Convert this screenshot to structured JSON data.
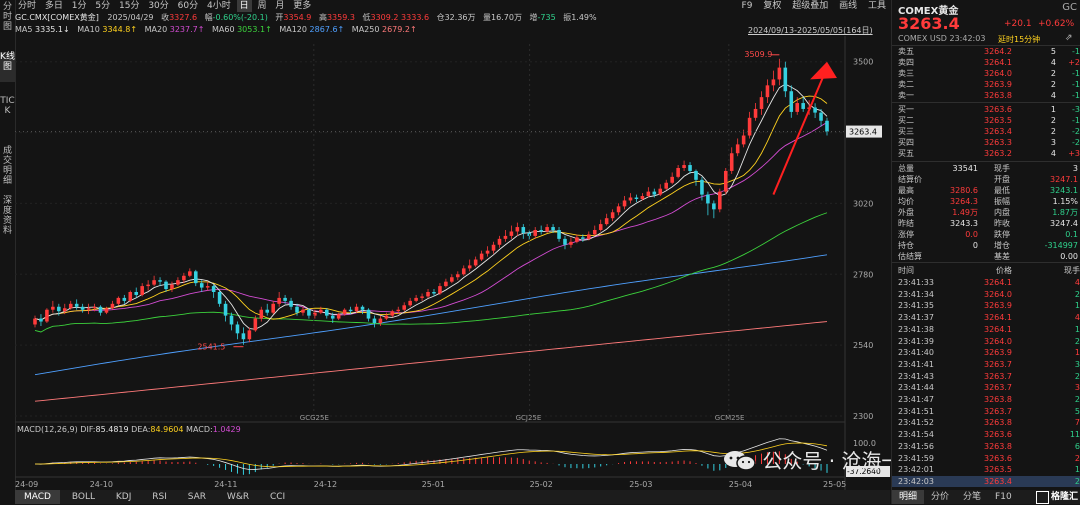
{
  "left_tabs": [
    "分时图",
    "K线图",
    "TICK",
    "成交明细",
    "深度资料"
  ],
  "periods": [
    "分时",
    "多日",
    "1分",
    "5分",
    "15分",
    "30分",
    "60分",
    "4小时",
    "日",
    "周",
    "月",
    "更多"
  ],
  "active_period": "日",
  "top_links": [
    "F9",
    "复权",
    "超级叠加",
    "画线",
    "工具"
  ],
  "info": {
    "symbol": "GC.CMX[COMEX黄金]",
    "date": "2025/04/29",
    "close_label": "收",
    "close": "3327.6",
    "chg_label": "幅",
    "chg": "-0.60%(-20.1)",
    "open_label": "开",
    "open": "3354.9",
    "high_label": "高",
    "high": "3359.3",
    "low_label": "低",
    "low": "3309.2",
    "last": "3333.6",
    "oi_label": "仓",
    "oi": "32.36万",
    "vol_label": "量",
    "vol": "16.70万",
    "inc_label": "增",
    "inc": "-735",
    "amp_label": "振",
    "amp": "1.49%"
  },
  "ma": [
    {
      "label": "MA5",
      "value": "3335.1↓",
      "color": "#e6e6e6"
    },
    {
      "label": "MA10",
      "value": "3344.8↑",
      "color": "#ffd21f"
    },
    {
      "label": "MA20",
      "value": "3237.7↑",
      "color": "#d24cd2"
    },
    {
      "label": "MA60",
      "value": "3053.1↑",
      "color": "#3cd23c"
    },
    {
      "label": "MA120",
      "value": "2867.6↑",
      "color": "#4fa0ff"
    },
    {
      "label": "MA250",
      "value": "2679.2↑",
      "color": "#ff7a7a"
    }
  ],
  "range_label": "2024/09/13-2025/05/05(164日)",
  "price_axis": [
    "3500",
    "3260",
    "3020",
    "2780",
    "2540",
    "2300"
  ],
  "current_price_tag": "3263.4",
  "max_label": "3509.9",
  "min_label": "2541.5",
  "contract_labels": [
    "GCG25E",
    "GCJ25E",
    "GCM25E"
  ],
  "macd": {
    "title": "MACD(12,26,9)",
    "dif_label": "DIF:",
    "dif": "85.4819",
    "dea_label": "DEA:",
    "dea": "84.9604",
    "macd_label": "MACD:",
    "macd": "1.0429",
    "axis_top": "100.0",
    "axis_bot": "-37.2640"
  },
  "date_axis": [
    "24-09",
    "24-10",
    "24-11",
    "24-12",
    "25-01",
    "25-02",
    "25-03",
    "25-04",
    "25-05"
  ],
  "bottom_tabs": [
    "MACD",
    "BOLL",
    "KDJ",
    "RSI",
    "SAR",
    "W&R",
    "CCI"
  ],
  "watermark": "公众号 · 沧海一土狗",
  "right": {
    "name": "COMEX黄金",
    "code": "GC",
    "price": "3263.4",
    "chg": "+20.1",
    "pct": "+0.62%",
    "sub": "COMEX  USD  23:42:03",
    "delay": "延时15分钟",
    "asks": [
      {
        "l": "卖五",
        "p": "3264.2",
        "v": "5",
        "d": "-1"
      },
      {
        "l": "卖四",
        "p": "3264.1",
        "v": "4",
        "d": "+2"
      },
      {
        "l": "卖三",
        "p": "3264.0",
        "v": "2",
        "d": "-1"
      },
      {
        "l": "卖二",
        "p": "3263.9",
        "v": "2",
        "d": "-1"
      },
      {
        "l": "卖一",
        "p": "3263.8",
        "v": "4",
        "d": "-1"
      }
    ],
    "bids": [
      {
        "l": "买一",
        "p": "3263.6",
        "v": "1",
        "d": "-3"
      },
      {
        "l": "买二",
        "p": "3263.5",
        "v": "2",
        "d": "-1"
      },
      {
        "l": "买三",
        "p": "3263.4",
        "v": "2",
        "d": "-2"
      },
      {
        "l": "买四",
        "p": "3263.3",
        "v": "3",
        "d": "-2"
      },
      {
        "l": "买五",
        "p": "3263.2",
        "v": "4",
        "d": "+3"
      }
    ],
    "stats": [
      {
        "a": "总量",
        "av": "33541",
        "b": "现手",
        "bv": "3"
      },
      {
        "a": "结算价",
        "av": "",
        "b": "开盘",
        "bv": "3247.1"
      },
      {
        "a": "最高",
        "av": "3280.6",
        "b": "最低",
        "bv": "3243.1"
      },
      {
        "a": "均价",
        "av": "3264.3",
        "b": "振幅",
        "bv": "1.15%"
      },
      {
        "a": "外盘",
        "av": "1.49万",
        "b": "内盘",
        "bv": "1.87万"
      },
      {
        "a": "昨结",
        "av": "3243.3",
        "b": "昨收",
        "bv": "3247.4"
      },
      {
        "a": "涨停",
        "av": "0.0",
        "b": "跌停",
        "bv": "0.1"
      },
      {
        "a": "持仓",
        "av": "0",
        "b": "增仓",
        "bv": "-314997"
      },
      {
        "a": "估结算",
        "av": "",
        "b": "基差",
        "bv": "0.00"
      }
    ],
    "tick_head": [
      "时间",
      "价格",
      "现手"
    ],
    "ticks": [
      {
        "t": "23:41:33",
        "p": "3264.1",
        "v": "4"
      },
      {
        "t": "23:41:34",
        "p": "3264.0",
        "v": "2"
      },
      {
        "t": "23:41:35",
        "p": "3263.9",
        "v": "1"
      },
      {
        "t": "23:41:37",
        "p": "3264.1",
        "v": "4"
      },
      {
        "t": "23:41:38",
        "p": "3264.1",
        "v": "1"
      },
      {
        "t": "23:41:39",
        "p": "3264.0",
        "v": "2"
      },
      {
        "t": "23:41:40",
        "p": "3263.9",
        "v": "1"
      },
      {
        "t": "23:41:41",
        "p": "3263.7",
        "v": "3"
      },
      {
        "t": "23:41:43",
        "p": "3263.7",
        "v": "2"
      },
      {
        "t": "23:41:44",
        "p": "3263.7",
        "v": "3"
      },
      {
        "t": "23:41:47",
        "p": "3263.8",
        "v": "2"
      },
      {
        "t": "23:41:51",
        "p": "3263.7",
        "v": "5"
      },
      {
        "t": "23:41:52",
        "p": "3263.8",
        "v": "7"
      },
      {
        "t": "23:41:54",
        "p": "3263.6",
        "v": "11"
      },
      {
        "t": "23:41:56",
        "p": "3263.8",
        "v": "6"
      },
      {
        "t": "23:41:59",
        "p": "3263.6",
        "v": "2"
      },
      {
        "t": "23:42:01",
        "p": "3263.5",
        "v": "1"
      },
      {
        "t": "23:42:03",
        "p": "3263.4",
        "v": "2"
      }
    ],
    "bottom_tabs": [
      "明细",
      "分价",
      "分笔",
      "F10"
    ],
    "logo": "格隆汇"
  },
  "chart_data": {
    "type": "candlestick",
    "y_range": [
      2300,
      3560
    ],
    "x_labels": [
      "24-09",
      "24-10",
      "24-11",
      "24-12",
      "25-01",
      "25-02",
      "25-03",
      "25-04",
      "25-05"
    ],
    "candles": [
      [
        2610,
        2630,
        2600,
        2640
      ],
      [
        2630,
        2620,
        2605,
        2645
      ],
      [
        2620,
        2660,
        2615,
        2665
      ],
      [
        2660,
        2670,
        2650,
        2690
      ],
      [
        2670,
        2655,
        2640,
        2680
      ],
      [
        2655,
        2665,
        2645,
        2680
      ],
      [
        2665,
        2680,
        2660,
        2690
      ],
      [
        2680,
        2670,
        2660,
        2695
      ],
      [
        2670,
        2660,
        2650,
        2680
      ],
      [
        2660,
        2665,
        2645,
        2680
      ],
      [
        2665,
        2670,
        2655,
        2680
      ],
      [
        2670,
        2650,
        2640,
        2675
      ],
      [
        2650,
        2665,
        2645,
        2670
      ],
      [
        2665,
        2680,
        2660,
        2690
      ],
      [
        2680,
        2700,
        2675,
        2705
      ],
      [
        2700,
        2690,
        2680,
        2710
      ],
      [
        2690,
        2720,
        2685,
        2725
      ],
      [
        2720,
        2710,
        2700,
        2735
      ],
      [
        2710,
        2740,
        2705,
        2750
      ],
      [
        2740,
        2745,
        2725,
        2760
      ],
      [
        2745,
        2760,
        2740,
        2775
      ],
      [
        2760,
        2755,
        2740,
        2770
      ],
      [
        2755,
        2730,
        2720,
        2760
      ],
      [
        2730,
        2745,
        2720,
        2755
      ],
      [
        2745,
        2760,
        2740,
        2770
      ],
      [
        2760,
        2775,
        2750,
        2785
      ],
      [
        2775,
        2790,
        2770,
        2800
      ],
      [
        2790,
        2750,
        2740,
        2795
      ],
      [
        2750,
        2735,
        2720,
        2760
      ],
      [
        2735,
        2740,
        2725,
        2755
      ],
      [
        2740,
        2720,
        2700,
        2745
      ],
      [
        2720,
        2680,
        2670,
        2725
      ],
      [
        2680,
        2640,
        2620,
        2690
      ],
      [
        2640,
        2610,
        2590,
        2650
      ],
      [
        2610,
        2580,
        2560,
        2620
      ],
      [
        2580,
        2560,
        2541.5,
        2600
      ],
      [
        2560,
        2590,
        2550,
        2600
      ],
      [
        2590,
        2630,
        2585,
        2640
      ],
      [
        2630,
        2660,
        2620,
        2670
      ],
      [
        2660,
        2650,
        2640,
        2680
      ],
      [
        2650,
        2680,
        2645,
        2690
      ],
      [
        2680,
        2700,
        2670,
        2720
      ],
      [
        2700,
        2690,
        2680,
        2710
      ],
      [
        2690,
        2670,
        2660,
        2700
      ],
      [
        2670,
        2650,
        2640,
        2680
      ],
      [
        2650,
        2660,
        2640,
        2670
      ],
      [
        2660,
        2640,
        2630,
        2665
      ],
      [
        2640,
        2650,
        2630,
        2660
      ],
      [
        2650,
        2660,
        2645,
        2670
      ],
      [
        2660,
        2640,
        2630,
        2665
      ],
      [
        2640,
        2630,
        2615,
        2650
      ],
      [
        2630,
        2645,
        2625,
        2650
      ],
      [
        2645,
        2660,
        2640,
        2665
      ],
      [
        2660,
        2655,
        2645,
        2670
      ],
      [
        2655,
        2670,
        2650,
        2680
      ],
      [
        2670,
        2660,
        2645,
        2675
      ],
      [
        2660,
        2630,
        2620,
        2665
      ],
      [
        2630,
        2615,
        2600,
        2640
      ],
      [
        2615,
        2630,
        2605,
        2640
      ],
      [
        2630,
        2640,
        2625,
        2650
      ],
      [
        2640,
        2655,
        2635,
        2660
      ],
      [
        2655,
        2660,
        2645,
        2670
      ],
      [
        2660,
        2675,
        2655,
        2685
      ],
      [
        2675,
        2690,
        2670,
        2700
      ],
      [
        2690,
        2700,
        2685,
        2710
      ],
      [
        2700,
        2705,
        2690,
        2715
      ],
      [
        2705,
        2720,
        2700,
        2730
      ],
      [
        2720,
        2715,
        2705,
        2730
      ],
      [
        2715,
        2740,
        2710,
        2750
      ],
      [
        2740,
        2755,
        2735,
        2765
      ],
      [
        2755,
        2770,
        2750,
        2780
      ],
      [
        2770,
        2780,
        2760,
        2790
      ],
      [
        2780,
        2800,
        2775,
        2810
      ],
      [
        2800,
        2810,
        2790,
        2830
      ],
      [
        2810,
        2830,
        2805,
        2840
      ],
      [
        2830,
        2850,
        2825,
        2860
      ],
      [
        2850,
        2860,
        2840,
        2875
      ],
      [
        2860,
        2880,
        2850,
        2890
      ],
      [
        2880,
        2900,
        2870,
        2910
      ],
      [
        2900,
        2910,
        2890,
        2930
      ],
      [
        2910,
        2925,
        2900,
        2945
      ],
      [
        2925,
        2940,
        2910,
        2955
      ],
      [
        2940,
        2920,
        2900,
        2950
      ],
      [
        2920,
        2910,
        2895,
        2930
      ],
      [
        2910,
        2930,
        2900,
        2940
      ],
      [
        2930,
        2925,
        2915,
        2945
      ],
      [
        2925,
        2940,
        2920,
        2950
      ],
      [
        2940,
        2930,
        2920,
        2950
      ],
      [
        2930,
        2900,
        2890,
        2940
      ],
      [
        2900,
        2880,
        2865,
        2910
      ],
      [
        2880,
        2890,
        2870,
        2905
      ],
      [
        2890,
        2905,
        2885,
        2915
      ],
      [
        2905,
        2900,
        2890,
        2915
      ],
      [
        2900,
        2915,
        2895,
        2925
      ],
      [
        2915,
        2930,
        2910,
        2945
      ],
      [
        2930,
        2950,
        2925,
        2965
      ],
      [
        2950,
        2970,
        2945,
        2985
      ],
      [
        2970,
        2990,
        2960,
        3000
      ],
      [
        2990,
        3010,
        2980,
        3020
      ],
      [
        3010,
        3030,
        3000,
        3045
      ],
      [
        3030,
        3040,
        3020,
        3055
      ],
      [
        3040,
        3035,
        3025,
        3050
      ],
      [
        3035,
        3045,
        3030,
        3055
      ],
      [
        3045,
        3060,
        3040,
        3075
      ],
      [
        3060,
        3050,
        3040,
        3070
      ],
      [
        3050,
        3070,
        3045,
        3085
      ],
      [
        3070,
        3090,
        3065,
        3100
      ],
      [
        3090,
        3110,
        3085,
        3125
      ],
      [
        3110,
        3140,
        3105,
        3150
      ],
      [
        3140,
        3150,
        3130,
        3165
      ],
      [
        3150,
        3130,
        3120,
        3160
      ],
      [
        3130,
        3100,
        3080,
        3135
      ],
      [
        3100,
        3050,
        3030,
        3110
      ],
      [
        3050,
        3020,
        2980,
        3060
      ],
      [
        3020,
        3000,
        2970,
        3030
      ],
      [
        3000,
        3060,
        2990,
        3070
      ],
      [
        3060,
        3130,
        3050,
        3140
      ],
      [
        3130,
        3190,
        3120,
        3210
      ],
      [
        3190,
        3220,
        3180,
        3240
      ],
      [
        3220,
        3250,
        3210,
        3270
      ],
      [
        3250,
        3310,
        3240,
        3330
      ],
      [
        3310,
        3340,
        3300,
        3360
      ],
      [
        3340,
        3380,
        3320,
        3400
      ],
      [
        3380,
        3420,
        3360,
        3440
      ],
      [
        3420,
        3440,
        3400,
        3470
      ],
      [
        3440,
        3480,
        3420,
        3509.9
      ],
      [
        3480,
        3400,
        3380,
        3500
      ],
      [
        3400,
        3330,
        3310,
        3420
      ],
      [
        3330,
        3360,
        3320,
        3380
      ],
      [
        3360,
        3340,
        3330,
        3380
      ],
      [
        3340,
        3345,
        3320,
        3370
      ],
      [
        3345,
        3327.6,
        3309.2,
        3359.3
      ],
      [
        3327.6,
        3300,
        3280,
        3340
      ],
      [
        3300,
        3263.4,
        3250,
        3310
      ]
    ]
  }
}
